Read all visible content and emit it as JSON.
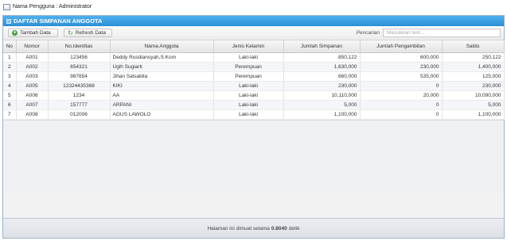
{
  "user_bar": {
    "text": "Nama Pengguna : Administrator"
  },
  "panel": {
    "title": "DAFTAR SIMPANAN ANGGOTA"
  },
  "toolbar": {
    "add_label": "Tambah Data",
    "refresh_label": "Refresh Data",
    "search_label": "Pencarian",
    "search_placeholder": "Masukkan text...",
    "add_icon": "add-icon",
    "refresh_icon": "refresh-icon"
  },
  "table": {
    "columns": [
      "No",
      "Nomor",
      "No.Identitas",
      "Nama Anggota",
      "Jenis Kelamin",
      "Jumlah Simpanan",
      "Jumlah Pengambilan",
      "Saldo"
    ],
    "rows": [
      [
        "1",
        "A001",
        "123456",
        "Deddy Rusdiansyah,S.Kom",
        "Laki-laki",
        "850,122",
        "600,000",
        "250,122"
      ],
      [
        "2",
        "A002",
        "654321",
        "Ugih Sugiarti",
        "Perempuan",
        "1,630,000",
        "230,000",
        "1,400,000"
      ],
      [
        "3",
        "A003",
        "987654",
        "Jihan Salsabila",
        "Perempuan",
        "660,000",
        "535,000",
        "125,000"
      ],
      [
        "4",
        "A005",
        "12324435368",
        "KIKI",
        "Laki-laki",
        "230,000",
        "0",
        "230,000"
      ],
      [
        "5",
        "A006",
        "1234",
        "AA",
        "Laki-laki",
        "10,110,000",
        "20,000",
        "10,090,000"
      ],
      [
        "6",
        "A007",
        "157777",
        "ARPANI",
        "Laki-laki",
        "5,000",
        "0",
        "5,000"
      ],
      [
        "7",
        "A008",
        "012006",
        "AGUS LAWOLO",
        "Laki-laki",
        "1,100,000",
        "0",
        "1,100,000"
      ]
    ]
  },
  "footer": {
    "prefix": "Halaman ini dimuat selama",
    "time": "0.8040",
    "suffix": "detik"
  },
  "colors": {
    "header_blue": "#2b8fd6",
    "add_green": "#3b9e3b"
  }
}
